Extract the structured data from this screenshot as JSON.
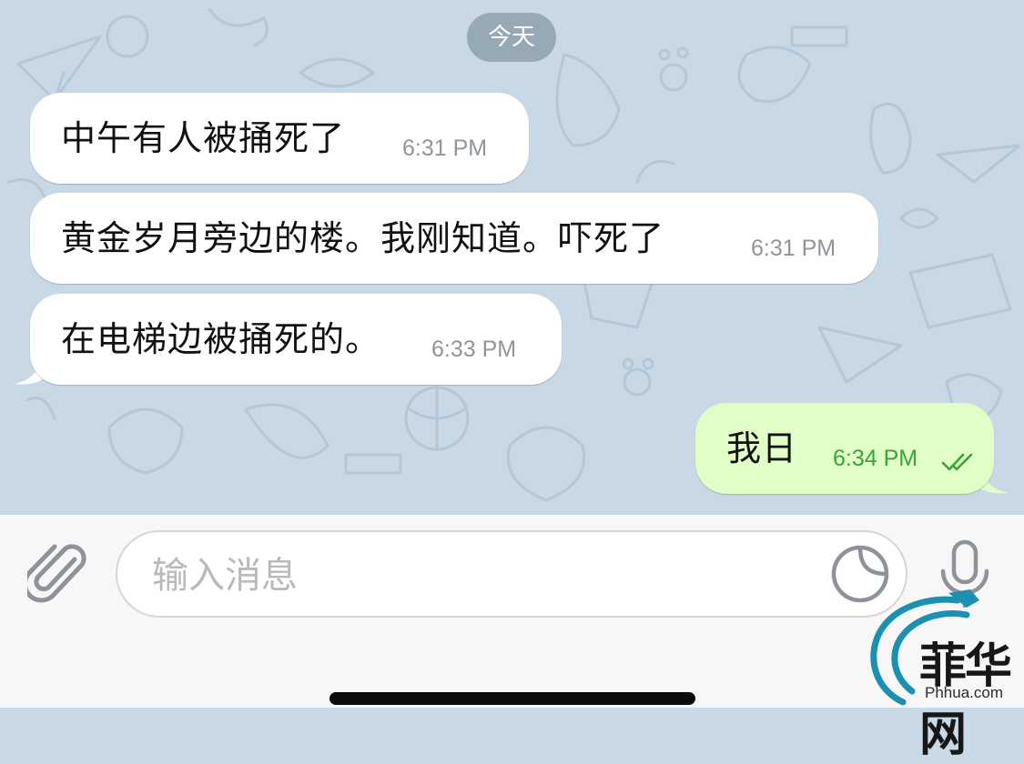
{
  "chat": {
    "date_label": "今天",
    "messages": [
      {
        "direction": "incoming",
        "text": "中午有人被捅死了",
        "time": "6:31 PM"
      },
      {
        "direction": "incoming",
        "text": "黄金岁月旁边的楼。我刚知道。吓死了",
        "time": "6:31 PM"
      },
      {
        "direction": "incoming",
        "text": "在电梯边被捅死的。",
        "time": "6:33 PM"
      },
      {
        "direction": "outgoing",
        "text": "我日",
        "time": "6:34 PM",
        "status_icon": "double-check-icon"
      }
    ]
  },
  "input_bar": {
    "attach_icon": "paperclip-icon",
    "placeholder": "输入消息",
    "value": "",
    "sticker_icon": "sticker-icon",
    "mic_icon": "microphone-icon"
  },
  "watermark": {
    "logo_text": "菲华网",
    "url": "Phhua.com"
  },
  "colors": {
    "wallpaper": "#c8d8e5",
    "incoming_bubble": "#ffffff",
    "outgoing_bubble": "#e1fec6",
    "outgoing_time": "#3aa33a",
    "date_pill": "#98a9b6"
  }
}
